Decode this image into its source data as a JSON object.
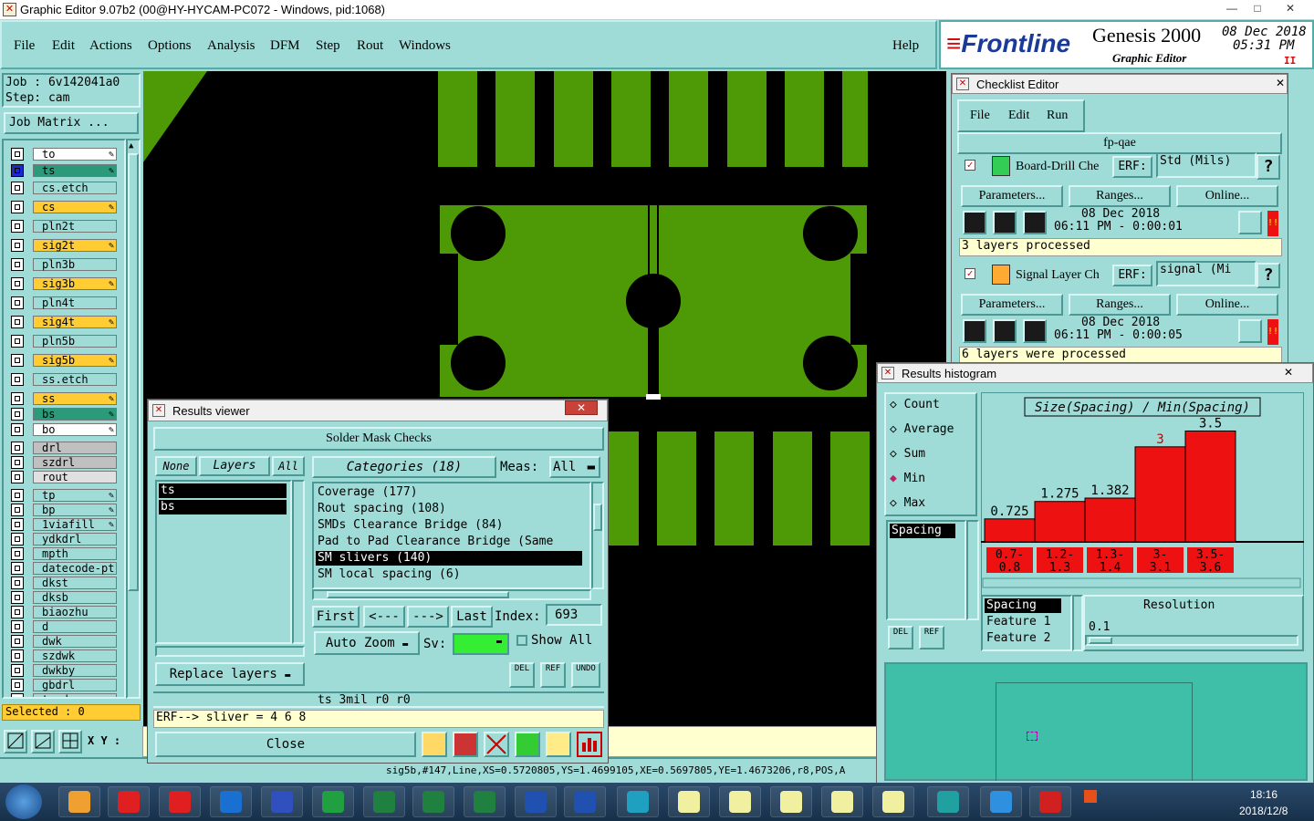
{
  "window": {
    "title": "Graphic Editor 9.07b2 (00@HY-HYCAM-PC072 - Windows, pid:1068)",
    "btn_min": "—",
    "btn_max": "□",
    "btn_close": "✕"
  },
  "menu": {
    "items": [
      "File",
      "Edit",
      "Actions",
      "Options",
      "Analysis",
      "DFM",
      "Step",
      "Rout",
      "Windows"
    ],
    "help": "Help"
  },
  "brand": {
    "logo": "Frontline",
    "product": "Genesis 2000",
    "subtitle": "Graphic Editor",
    "date": "08 Dec 2018",
    "time": "05:31 PM",
    "pause": "II"
  },
  "job": {
    "job": "Job : 6v142041a0",
    "step": "Step: cam",
    "matrix": "Job Matrix ..."
  },
  "layers": [
    {
      "name": "to",
      "bg": "#ffffff",
      "mark": "✎"
    },
    {
      "name": "ts",
      "bg": "#2a9a7a",
      "mark": "✎",
      "active": true
    },
    {
      "name": "cs.etch",
      "bg": "#9fdcd8",
      "mark": ""
    },
    {
      "name": "cs",
      "bg": "#ffcc33",
      "mark": "✎"
    },
    {
      "name": "pln2t",
      "bg": "#9fdcd8",
      "mark": ""
    },
    {
      "name": "sig2t",
      "bg": "#ffcc33",
      "mark": "✎"
    },
    {
      "name": "pln3b",
      "bg": "#9fdcd8",
      "mark": ""
    },
    {
      "name": "sig3b",
      "bg": "#ffcc33",
      "mark": "✎"
    },
    {
      "name": "pln4t",
      "bg": "#9fdcd8",
      "mark": ""
    },
    {
      "name": "sig4t",
      "bg": "#ffcc33",
      "mark": "✎"
    },
    {
      "name": "pln5b",
      "bg": "#9fdcd8",
      "mark": ""
    },
    {
      "name": "sig5b",
      "bg": "#ffcc33",
      "mark": "✎"
    },
    {
      "name": "ss.etch",
      "bg": "#9fdcd8",
      "mark": ""
    },
    {
      "name": "ss",
      "bg": "#ffcc33",
      "mark": "✎"
    },
    {
      "name": "bs",
      "bg": "#2a9a7a",
      "mark": "✎"
    },
    {
      "name": "bo",
      "bg": "#ffffff",
      "mark": "✎"
    },
    {
      "name": "drl",
      "bg": "#c0c0c0",
      "mark": ""
    },
    {
      "name": "szdrl",
      "bg": "#c0c0c0",
      "mark": ""
    },
    {
      "name": "rout",
      "bg": "#e0e0e0",
      "mark": ""
    },
    {
      "name": "tp",
      "bg": "#9fdcd8",
      "mark": "✎"
    },
    {
      "name": "bp",
      "bg": "#9fdcd8",
      "mark": "✎"
    },
    {
      "name": "1viafill",
      "bg": "#9fdcd8",
      "mark": "✎"
    },
    {
      "name": "ydkdrl",
      "bg": "#9fdcd8",
      "mark": ""
    },
    {
      "name": "mpth",
      "bg": "#9fdcd8",
      "mark": ""
    },
    {
      "name": "datecode-pt",
      "bg": "#9fdcd8",
      "mark": ""
    },
    {
      "name": "dkst",
      "bg": "#9fdcd8",
      "mark": ""
    },
    {
      "name": "dksb",
      "bg": "#9fdcd8",
      "mark": ""
    },
    {
      "name": "biaozhu",
      "bg": "#9fdcd8",
      "mark": ""
    },
    {
      "name": "d",
      "bg": "#9fdcd8",
      "mark": ""
    },
    {
      "name": "dwk",
      "bg": "#9fdcd8",
      "mark": ""
    },
    {
      "name": "szdwk",
      "bg": "#9fdcd8",
      "mark": ""
    },
    {
      "name": "dwkby",
      "bg": "#9fdcd8",
      "mark": ""
    },
    {
      "name": "gbdrl",
      "bg": "#9fdcd8",
      "mark": ""
    },
    {
      "name": "to d",
      "bg": "#9fdcd8",
      "mark": ""
    }
  ],
  "selected": "Selected : 0",
  "xy": "X Y :",
  "status_line": "sig5b,#147,Line,XS=0.5720805,YS=1.4699105,XE=0.5697805,YE=1.4673206,r8,POS,A",
  "results_viewer": {
    "title": "Results viewer",
    "header": "Solder Mask Checks",
    "none": "None",
    "layers_btn": "Layers",
    "all": "All",
    "categories": "Categories (18)",
    "meas": "Meas:",
    "meas_val": "All",
    "layer_list": [
      "ts",
      "bs"
    ],
    "cat_list": [
      "Coverage (177)",
      "Rout spacing (108)",
      "SMDs Clearance Bridge (84)",
      "Pad to Pad Clearance Bridge (Same",
      "SM slivers (140)",
      "SM local spacing (6)"
    ],
    "selected_cat": 4,
    "first": "First",
    "prev": "<---",
    "next": "--->",
    "last": "Last",
    "index_lbl": "Index:",
    "index_val": "693",
    "auto_zoom": "Auto Zoom",
    "sv": "Sv:",
    "show_all": "Show All",
    "replace": "Replace layers",
    "del": "DEL",
    "ref": "REF",
    "undo": "UNDO",
    "info": "ts 3mil  r0  r0",
    "erf": "ERF--> sliver = 4 6 8",
    "close": "Close",
    "close_x": "✕"
  },
  "checklist": {
    "title": "Checklist Editor",
    "close_x": "✕",
    "menu": [
      "File",
      "Edit",
      "Run"
    ],
    "name": "fp-qae",
    "erf_label": "ERF:",
    "params": "Parameters...",
    "ranges": "Ranges...",
    "online": "Online...",
    "help": "?",
    "items": [
      {
        "name": "Board-Drill Che",
        "erf": "Std (Mils)",
        "date": "08 Dec 2018",
        "time": "06:11 PM - 0:00:01",
        "status": "3 layers processed"
      },
      {
        "name": "Signal Layer Ch",
        "erf": "signal (Mi",
        "date": "08 Dec 2018",
        "time": "06:11 PM - 0:00:05",
        "status": "6 layers were processed"
      }
    ]
  },
  "histogram": {
    "title": "Results histogram",
    "close_x": "✕",
    "options": [
      "Count",
      "Average",
      "Sum",
      "Min",
      "Max"
    ],
    "selected": "Min",
    "list": [
      "Spacing"
    ],
    "del": "DEL",
    "ref": "REF",
    "sel_list": [
      "Spacing",
      "Feature 1",
      "Feature 2"
    ],
    "resolution_lbl": "Resolution",
    "resolution_val": "0.1"
  },
  "chart_data": {
    "type": "bar",
    "title": "Size(Spacing) / Min(Spacing)",
    "categories": [
      "0.7-0.8",
      "1.2-1.3",
      "1.3-1.4",
      "3-3.1",
      "3.5-3.6"
    ],
    "values": [
      0.725,
      1.275,
      1.382,
      3,
      3.5
    ],
    "value_labels": [
      "0.725",
      "1.275",
      "1.382",
      "3",
      "3.5"
    ],
    "ylim": [
      0,
      3.6
    ],
    "color": "#ee1111"
  },
  "clock": {
    "time": "18:16",
    "date": "2018/12/8"
  }
}
